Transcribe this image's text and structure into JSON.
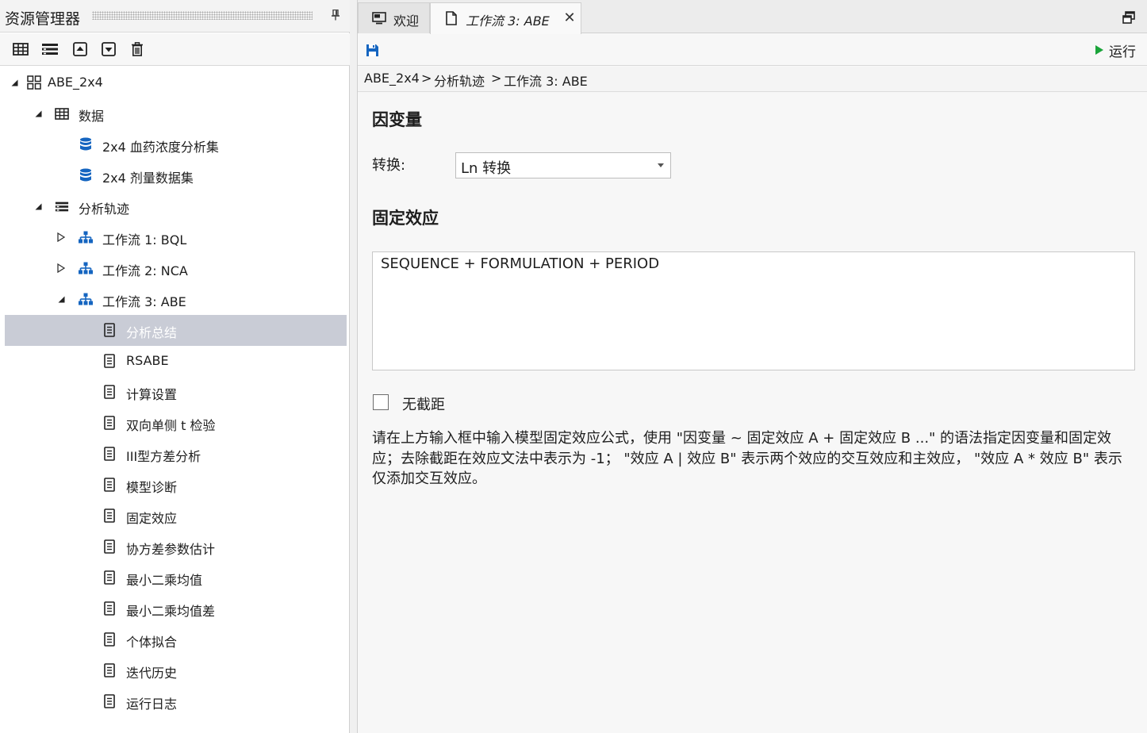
{
  "explorer": {
    "title": "资源管理器",
    "toolbar": [
      {
        "name": "grid-view-button",
        "icon": "grid-icon"
      },
      {
        "name": "list-view-button",
        "icon": "list-icon"
      },
      {
        "name": "move-up-button",
        "icon": "arrow-up-box-icon"
      },
      {
        "name": "move-down-button",
        "icon": "arrow-down-box-icon"
      },
      {
        "name": "delete-button",
        "icon": "trash-icon"
      }
    ],
    "tree": [
      {
        "label": "ABE_2x4",
        "level": 0,
        "expander": "expanded",
        "icon": "project-icon"
      },
      {
        "label": "数据",
        "level": 1,
        "expander": "expanded",
        "icon": "table-icon"
      },
      {
        "label": "2x4 血药浓度分析集",
        "level": 2,
        "expander": "none",
        "icon": "database-icon"
      },
      {
        "label": "2x4 剂量数据集",
        "level": 2,
        "expander": "none",
        "icon": "database-icon"
      },
      {
        "label": "分析轨迹",
        "level": 1,
        "expander": "expanded",
        "icon": "stack-icon"
      },
      {
        "label": "工作流 1: BQL",
        "level": 2,
        "expander": "collapsed",
        "icon": "workflow-icon"
      },
      {
        "label": "工作流 2: NCA",
        "level": 2,
        "expander": "collapsed",
        "icon": "workflow-icon"
      },
      {
        "label": "工作流 3: ABE",
        "level": 2,
        "expander": "expanded",
        "icon": "workflow-icon"
      },
      {
        "label": "分析总结",
        "level": 3,
        "expander": "none",
        "icon": "document-icon",
        "selected": true
      },
      {
        "label": "RSABE",
        "level": 3,
        "expander": "none",
        "icon": "document-icon"
      },
      {
        "label": "计算设置",
        "level": 3,
        "expander": "none",
        "icon": "document-icon"
      },
      {
        "label": "双向单侧 t 检验",
        "level": 3,
        "expander": "none",
        "icon": "document-icon"
      },
      {
        "label": "III型方差分析",
        "level": 3,
        "expander": "none",
        "icon": "document-icon"
      },
      {
        "label": "模型诊断",
        "level": 3,
        "expander": "none",
        "icon": "document-icon"
      },
      {
        "label": "固定效应",
        "level": 3,
        "expander": "none",
        "icon": "document-icon"
      },
      {
        "label": "协方差参数估计",
        "level": 3,
        "expander": "none",
        "icon": "document-icon"
      },
      {
        "label": "最小二乘均值",
        "level": 3,
        "expander": "none",
        "icon": "document-icon"
      },
      {
        "label": "最小二乘均值差",
        "level": 3,
        "expander": "none",
        "icon": "document-icon"
      },
      {
        "label": "个体拟合",
        "level": 3,
        "expander": "none",
        "icon": "document-icon"
      },
      {
        "label": "迭代历史",
        "level": 3,
        "expander": "none",
        "icon": "document-icon"
      },
      {
        "label": "运行日志",
        "level": 3,
        "expander": "none",
        "icon": "document-icon"
      }
    ]
  },
  "tabs": {
    "welcome": {
      "label": "欢迎",
      "icon": "monitor-icon"
    },
    "workflow": {
      "label": "工作流 3: ABE",
      "icon": "file-icon",
      "close": "✕"
    }
  },
  "toolbar": {
    "save_icon": "save-icon",
    "run_label": "运行"
  },
  "breadcrumb": {
    "items": [
      "ABE_2x4",
      "分析轨迹",
      "工作流 3: ABE"
    ],
    "separator": ">"
  },
  "form": {
    "dependent_title": "因变量",
    "transform_label": "转换:",
    "transform_value": "Ln 转换",
    "fixed_effects_title": "固定效应",
    "formula": "SEQUENCE + FORMULATION + PERIOD",
    "no_intercept_label": "无截距",
    "no_intercept_checked": false,
    "help_text": "请在上方输入框中输入模型固定效应公式，使用 \"因变量 ~ 固定效应 A + 固定效应 B ...\" 的语法指定因变量和固定效应；去除截距在效应文法中表示为 -1； \"效应 A | 效应 B\" 表示两个效应的交互效应和主效应， \"效应 A * 效应 B\" 表示仅添加交互效应。"
  },
  "colors": {
    "accent_blue": "#1565c0",
    "run_green": "#1aa43a",
    "selection": "#c9ccd6"
  }
}
